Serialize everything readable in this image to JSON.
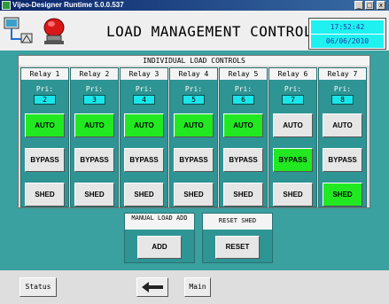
{
  "window": {
    "title": "Vijeo-Designer Runtime 5.0.0.537",
    "min_glyph": "_",
    "max_glyph": "□",
    "close_glyph": "x"
  },
  "header": {
    "title": "LOAD MANAGEMENT CONTROL",
    "time": "17:52:42",
    "date": "06/06/2010",
    "icons": [
      "network-icon",
      "alarm-beacon-icon"
    ]
  },
  "section": {
    "title": "INDIVIDUAL LOAD CONTROLS"
  },
  "relays": [
    {
      "label": "Relay 1",
      "pri_label": "Pri:",
      "pri": "2",
      "auto": "AUTO",
      "bypass": "BYPASS",
      "shed": "SHED",
      "active": "auto"
    },
    {
      "label": "Relay 2",
      "pri_label": "Pri:",
      "pri": "3",
      "auto": "AUTO",
      "bypass": "BYPASS",
      "shed": "SHED",
      "active": "auto"
    },
    {
      "label": "Relay 3",
      "pri_label": "Pri:",
      "pri": "4",
      "auto": "AUTO",
      "bypass": "BYPASS",
      "shed": "SHED",
      "active": "auto"
    },
    {
      "label": "Relay 4",
      "pri_label": "Pri:",
      "pri": "5",
      "auto": "AUTO",
      "bypass": "BYPASS",
      "shed": "SHED",
      "active": "auto"
    },
    {
      "label": "Relay 5",
      "pri_label": "Pri:",
      "pri": "6",
      "auto": "AUTO",
      "bypass": "BYPASS",
      "shed": "SHED",
      "active": "auto"
    },
    {
      "label": "Relay 6",
      "pri_label": "Pri:",
      "pri": "7",
      "auto": "AUTO",
      "bypass": "BYPASS",
      "shed": "SHED",
      "active": "bypass"
    },
    {
      "label": "Relay 7",
      "pri_label": "Pri:",
      "pri": "8",
      "auto": "AUTO",
      "bypass": "BYPASS",
      "shed": "SHED",
      "active": "shed"
    }
  ],
  "manual_load": {
    "title": "MANUAL LOAD ADD",
    "button": "ADD"
  },
  "reset_shed": {
    "title": "RESET SHED",
    "button": "RESET"
  },
  "footer": {
    "status_label": "Status",
    "back_glyph": "⟵",
    "main_label": "Main"
  },
  "colors": {
    "panel_bg": "#3aa0a0",
    "active_green": "#22e822",
    "value_cyan": "#19e6ea",
    "titlebar": "#0a246a"
  }
}
